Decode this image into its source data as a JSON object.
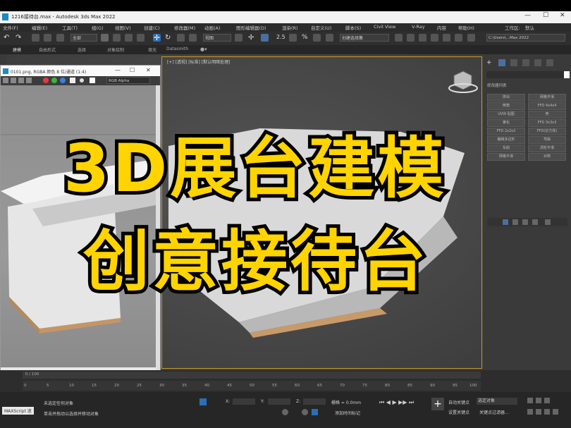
{
  "window": {
    "title": "1216接待台.max - Autodesk 3ds Max 2022",
    "controls": [
      "—",
      "☐",
      "✕"
    ]
  },
  "menubar": {
    "items": [
      "文件(F)",
      "编辑(E)",
      "工具(T)",
      "组(G)",
      "视图(V)",
      "创建(C)",
      "修改器(M)",
      "动画(A)",
      "图形编辑器(D)",
      "渲染(R)",
      "自定义(U)",
      "脚本(S)",
      "Civil View",
      "V-Ray",
      "内容",
      "帮助(H)"
    ],
    "workspace_label": "工作区:",
    "workspace_value": "默认"
  },
  "toolbar": {
    "selection_filter": "全部",
    "view_dropdown": "视图",
    "named_selection": "创建选择集",
    "path_field": "C:\\Users\\...Max 2022"
  },
  "ribbon": {
    "tabs": [
      "建模",
      "自由形式",
      "选择",
      "对象绘制",
      "填充",
      "Datasmith"
    ]
  },
  "viewport": {
    "label": "[+] [透视] [标准] [默认明暗处理]",
    "border_color": "#c59a28"
  },
  "float_window": {
    "title": "0101.png, RGBA 颜色 8 位/通道 (1:4)",
    "channel_dropdown": "RGB Alpha",
    "controls": [
      "—",
      "☐",
      "✕"
    ]
  },
  "command_panel": {
    "rollout_title": "修改器列表",
    "buttons": [
      "挤出",
      "网格平滑",
      "倒角",
      "FFD 4x4x4",
      "UVW 贴图",
      "壳",
      "锥化",
      "FFD 3x3x3",
      "FFD 2x2x2",
      "FFD(长方体)",
      "编辑多边形",
      "弯曲",
      "车削",
      "涡轮平滑",
      "网格平滑",
      "对称"
    ]
  },
  "timeline": {
    "frame_counter": "0 / 100",
    "ticks": [
      "0",
      "5",
      "10",
      "15",
      "20",
      "25",
      "30",
      "35",
      "40",
      "45",
      "50",
      "55",
      "60",
      "65",
      "70",
      "75",
      "80",
      "85",
      "90",
      "95",
      "100"
    ]
  },
  "statusbar": {
    "maxscript_label": "MAXScript 迷",
    "status_line1": "未选定任何对象",
    "status_line2": "单击并拖动以选择并移动对象",
    "x_label": "X:",
    "y_label": "Y:",
    "z_label": "Z:",
    "grid_label": "栅格 = 0.0mm",
    "add_time_tag": "添加时间标记",
    "autokey_label": "自动关键点",
    "autokey_value": "选定对象",
    "setkey_label": "设置关键点",
    "key_filters": "关键点过滤器..."
  },
  "overlay": {
    "line1": "3D展台建模",
    "line2": "创意接待台",
    "text_color": "#ffd400",
    "stroke_color": "#000000"
  }
}
